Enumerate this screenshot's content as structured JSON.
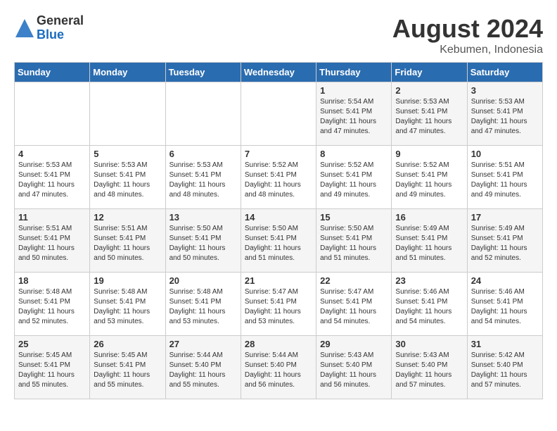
{
  "header": {
    "logo_general": "General",
    "logo_blue": "Blue",
    "month_year": "August 2024",
    "location": "Kebumen, Indonesia"
  },
  "weekdays": [
    "Sunday",
    "Monday",
    "Tuesday",
    "Wednesday",
    "Thursday",
    "Friday",
    "Saturday"
  ],
  "weeks": [
    [
      {
        "day": "",
        "info": ""
      },
      {
        "day": "",
        "info": ""
      },
      {
        "day": "",
        "info": ""
      },
      {
        "day": "",
        "info": ""
      },
      {
        "day": "1",
        "info": "Sunrise: 5:54 AM\nSunset: 5:41 PM\nDaylight: 11 hours\nand 47 minutes."
      },
      {
        "day": "2",
        "info": "Sunrise: 5:53 AM\nSunset: 5:41 PM\nDaylight: 11 hours\nand 47 minutes."
      },
      {
        "day": "3",
        "info": "Sunrise: 5:53 AM\nSunset: 5:41 PM\nDaylight: 11 hours\nand 47 minutes."
      }
    ],
    [
      {
        "day": "4",
        "info": "Sunrise: 5:53 AM\nSunset: 5:41 PM\nDaylight: 11 hours\nand 47 minutes."
      },
      {
        "day": "5",
        "info": "Sunrise: 5:53 AM\nSunset: 5:41 PM\nDaylight: 11 hours\nand 48 minutes."
      },
      {
        "day": "6",
        "info": "Sunrise: 5:53 AM\nSunset: 5:41 PM\nDaylight: 11 hours\nand 48 minutes."
      },
      {
        "day": "7",
        "info": "Sunrise: 5:52 AM\nSunset: 5:41 PM\nDaylight: 11 hours\nand 48 minutes."
      },
      {
        "day": "8",
        "info": "Sunrise: 5:52 AM\nSunset: 5:41 PM\nDaylight: 11 hours\nand 49 minutes."
      },
      {
        "day": "9",
        "info": "Sunrise: 5:52 AM\nSunset: 5:41 PM\nDaylight: 11 hours\nand 49 minutes."
      },
      {
        "day": "10",
        "info": "Sunrise: 5:51 AM\nSunset: 5:41 PM\nDaylight: 11 hours\nand 49 minutes."
      }
    ],
    [
      {
        "day": "11",
        "info": "Sunrise: 5:51 AM\nSunset: 5:41 PM\nDaylight: 11 hours\nand 50 minutes."
      },
      {
        "day": "12",
        "info": "Sunrise: 5:51 AM\nSunset: 5:41 PM\nDaylight: 11 hours\nand 50 minutes."
      },
      {
        "day": "13",
        "info": "Sunrise: 5:50 AM\nSunset: 5:41 PM\nDaylight: 11 hours\nand 50 minutes."
      },
      {
        "day": "14",
        "info": "Sunrise: 5:50 AM\nSunset: 5:41 PM\nDaylight: 11 hours\nand 51 minutes."
      },
      {
        "day": "15",
        "info": "Sunrise: 5:50 AM\nSunset: 5:41 PM\nDaylight: 11 hours\nand 51 minutes."
      },
      {
        "day": "16",
        "info": "Sunrise: 5:49 AM\nSunset: 5:41 PM\nDaylight: 11 hours\nand 51 minutes."
      },
      {
        "day": "17",
        "info": "Sunrise: 5:49 AM\nSunset: 5:41 PM\nDaylight: 11 hours\nand 52 minutes."
      }
    ],
    [
      {
        "day": "18",
        "info": "Sunrise: 5:48 AM\nSunset: 5:41 PM\nDaylight: 11 hours\nand 52 minutes."
      },
      {
        "day": "19",
        "info": "Sunrise: 5:48 AM\nSunset: 5:41 PM\nDaylight: 11 hours\nand 53 minutes."
      },
      {
        "day": "20",
        "info": "Sunrise: 5:48 AM\nSunset: 5:41 PM\nDaylight: 11 hours\nand 53 minutes."
      },
      {
        "day": "21",
        "info": "Sunrise: 5:47 AM\nSunset: 5:41 PM\nDaylight: 11 hours\nand 53 minutes."
      },
      {
        "day": "22",
        "info": "Sunrise: 5:47 AM\nSunset: 5:41 PM\nDaylight: 11 hours\nand 54 minutes."
      },
      {
        "day": "23",
        "info": "Sunrise: 5:46 AM\nSunset: 5:41 PM\nDaylight: 11 hours\nand 54 minutes."
      },
      {
        "day": "24",
        "info": "Sunrise: 5:46 AM\nSunset: 5:41 PM\nDaylight: 11 hours\nand 54 minutes."
      }
    ],
    [
      {
        "day": "25",
        "info": "Sunrise: 5:45 AM\nSunset: 5:41 PM\nDaylight: 11 hours\nand 55 minutes."
      },
      {
        "day": "26",
        "info": "Sunrise: 5:45 AM\nSunset: 5:41 PM\nDaylight: 11 hours\nand 55 minutes."
      },
      {
        "day": "27",
        "info": "Sunrise: 5:44 AM\nSunset: 5:40 PM\nDaylight: 11 hours\nand 55 minutes."
      },
      {
        "day": "28",
        "info": "Sunrise: 5:44 AM\nSunset: 5:40 PM\nDaylight: 11 hours\nand 56 minutes."
      },
      {
        "day": "29",
        "info": "Sunrise: 5:43 AM\nSunset: 5:40 PM\nDaylight: 11 hours\nand 56 minutes."
      },
      {
        "day": "30",
        "info": "Sunrise: 5:43 AM\nSunset: 5:40 PM\nDaylight: 11 hours\nand 57 minutes."
      },
      {
        "day": "31",
        "info": "Sunrise: 5:42 AM\nSunset: 5:40 PM\nDaylight: 11 hours\nand 57 minutes."
      }
    ]
  ]
}
